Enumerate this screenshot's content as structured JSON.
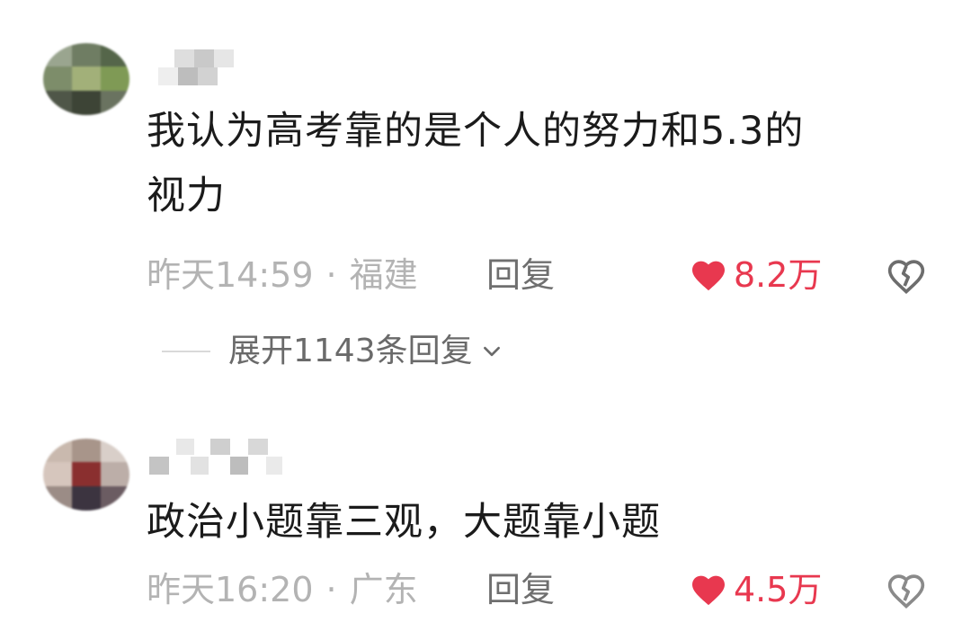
{
  "comments": [
    {
      "text_line1": "我认为高考靠的是个人的努力和5.3的",
      "text_line2": "视力",
      "time": "昨天14:59",
      "separator": "·",
      "location": "福建",
      "reply_label": "回复",
      "likes": "8.2万",
      "expand_label": "展开1143条回复"
    },
    {
      "text_line1": "政治小题靠三观，大题靠小题",
      "time": "昨天16:20",
      "separator": "·",
      "location": "广东",
      "reply_label": "回复",
      "likes": "4.5万"
    }
  ],
  "icons": {
    "like": "heart-icon",
    "dislike": "broken-heart-icon",
    "expand": "chevron-down-icon"
  },
  "colors": {
    "like": "#e8384f",
    "meta": "#b3b3b3",
    "text": "#1b1b1b"
  }
}
